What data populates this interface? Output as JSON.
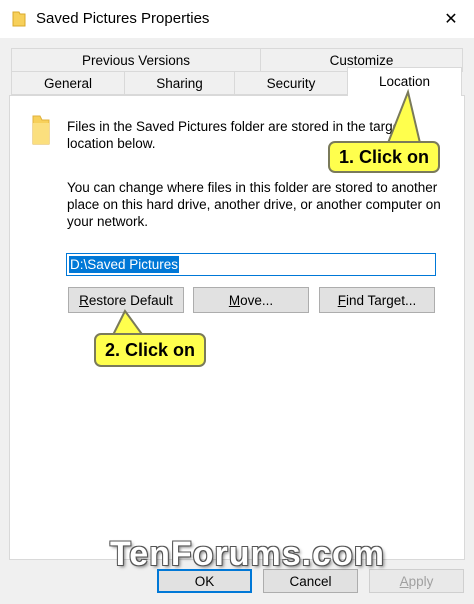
{
  "window": {
    "title": "Saved Pictures Properties",
    "close_glyph": "✕"
  },
  "tabs_row1": [
    {
      "label": "Previous Versions"
    },
    {
      "label": "Customize"
    }
  ],
  "tabs_row2": [
    {
      "label": "General"
    },
    {
      "label": "Sharing"
    },
    {
      "label": "Security"
    },
    {
      "label": "Location",
      "active": true
    }
  ],
  "location": {
    "info_line1": "Files in the Saved Pictures folder are stored in the target",
    "info_line2": "location below.",
    "desc_line1": "You can change where files in this folder are stored to another",
    "desc_line2": "place on this hard drive, another drive, or another computer on",
    "desc_line3": "your network.",
    "path_value": "D:\\Saved Pictures",
    "restore_prefix": "R",
    "restore_rest": "estore Default",
    "move_prefix": "M",
    "move_rest": "ove...",
    "find_prefix": "F",
    "find_rest": "ind Target..."
  },
  "callouts": {
    "step1": "1. Click on",
    "step2": "2. Click on"
  },
  "footer": {
    "ok": "OK",
    "cancel": "Cancel",
    "apply_prefix": "A",
    "apply_rest": "pply"
  },
  "watermark": "TenForums.com",
  "colors": {
    "accent": "#0078d7",
    "callout": "#ffff4d",
    "folder": "#f7d05a"
  }
}
